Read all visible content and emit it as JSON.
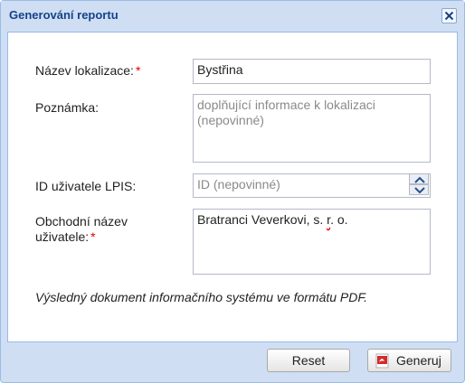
{
  "dialog": {
    "title": "Generování reportu"
  },
  "form": {
    "location_name_label": "Název lokalizace:",
    "required_mark": "*",
    "location_name_value": "Bystřina",
    "note_label": "Poznámka:",
    "note_placeholder": "doplňující informace k lokalizaci (nepovinné)",
    "lpis_id_label": "ID uživatele LPIS:",
    "lpis_id_placeholder": "ID (nepovinné)",
    "trade_name_label_line1": "Obchodní název",
    "trade_name_label_line2": "uživatele:",
    "trade_name_value_part1": "Bratranci Veverkovi, s. ",
    "trade_name_value_part2": "r",
    "trade_name_value_part3": ". o."
  },
  "info_text": "Výsledný dokument informačního systému ve formátu PDF.",
  "buttons": {
    "reset": "Reset",
    "generate": "Generuj"
  },
  "icons": {
    "close": "close-icon",
    "pdf": "pdf-icon",
    "spin_up": "chevron-up-icon",
    "spin_down": "chevron-down-icon"
  }
}
